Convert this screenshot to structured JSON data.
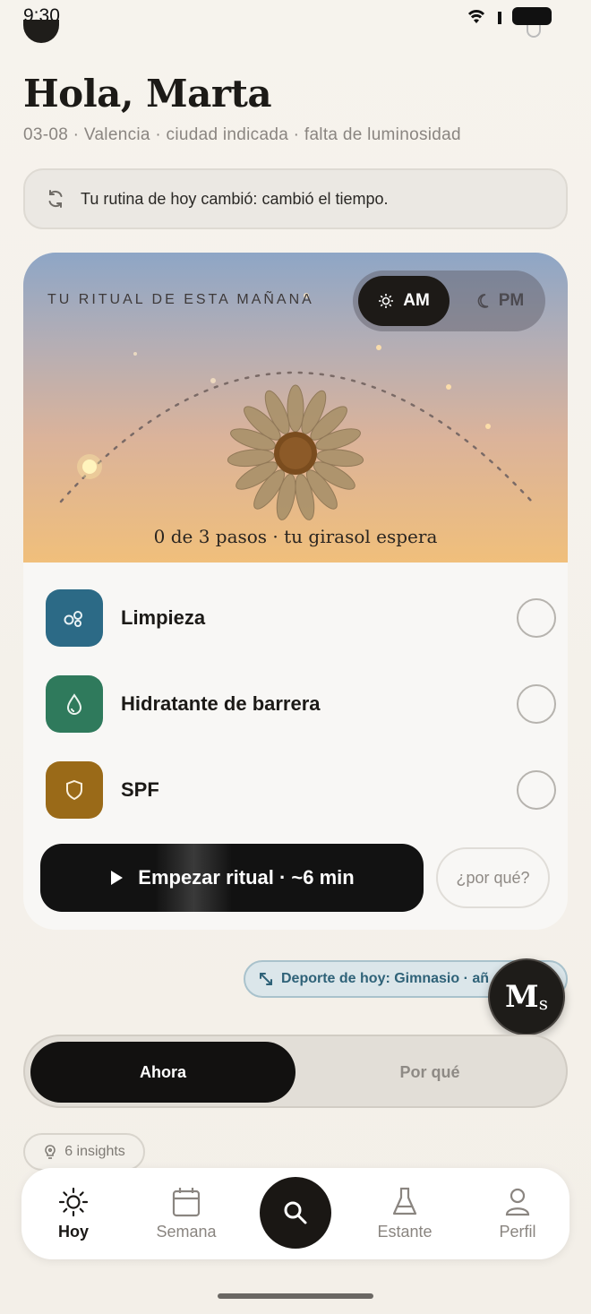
{
  "status": {
    "time": "9:30"
  },
  "header": {
    "greeting": "Hola, Marta",
    "subtitle": "03-08 · Valencia · ciudad indicada · falta de luminosidad"
  },
  "notice": {
    "text": "Tu rutina de hoy cambió: cambió el tiempo.",
    "icon": "refresh-icon"
  },
  "ritual": {
    "label": "TU RITUAL DE ESTA MAÑANA",
    "am_label": "AM",
    "pm_label": "PM",
    "selected": "AM",
    "progress_text": "0 de 3 pasos · tu girasol espera",
    "steps": [
      {
        "label": "Limpieza",
        "icon": "bubbles-icon",
        "color": "#2c6a86",
        "done": false
      },
      {
        "label": "Hidratante de barrera",
        "icon": "droplet-icon",
        "color": "#2f7a5c",
        "done": false
      },
      {
        "label": "SPF",
        "icon": "shield-icon",
        "color": "#9a6a18",
        "done": false
      }
    ],
    "start_label": "Empezar ritual · ~6 min",
    "why_label": "¿por qué?"
  },
  "sport_chip": {
    "text": "Deporte de hoy: Gimnasio · añ"
  },
  "avatar": {
    "initials": "M",
    "suffix": "s"
  },
  "segmented": {
    "active": "Ahora",
    "inactive": "Por qué"
  },
  "insights": {
    "label": "6 insights"
  },
  "tabbar": {
    "items": [
      {
        "label": "Hoy",
        "icon": "sun-icon",
        "active": true
      },
      {
        "label": "Semana",
        "icon": "calendar-icon",
        "active": false
      },
      {
        "label": "",
        "icon": "search-icon",
        "active": false
      },
      {
        "label": "Estante",
        "icon": "flask-icon",
        "active": false
      },
      {
        "label": "Perfil",
        "icon": "user-icon",
        "active": false
      }
    ]
  }
}
